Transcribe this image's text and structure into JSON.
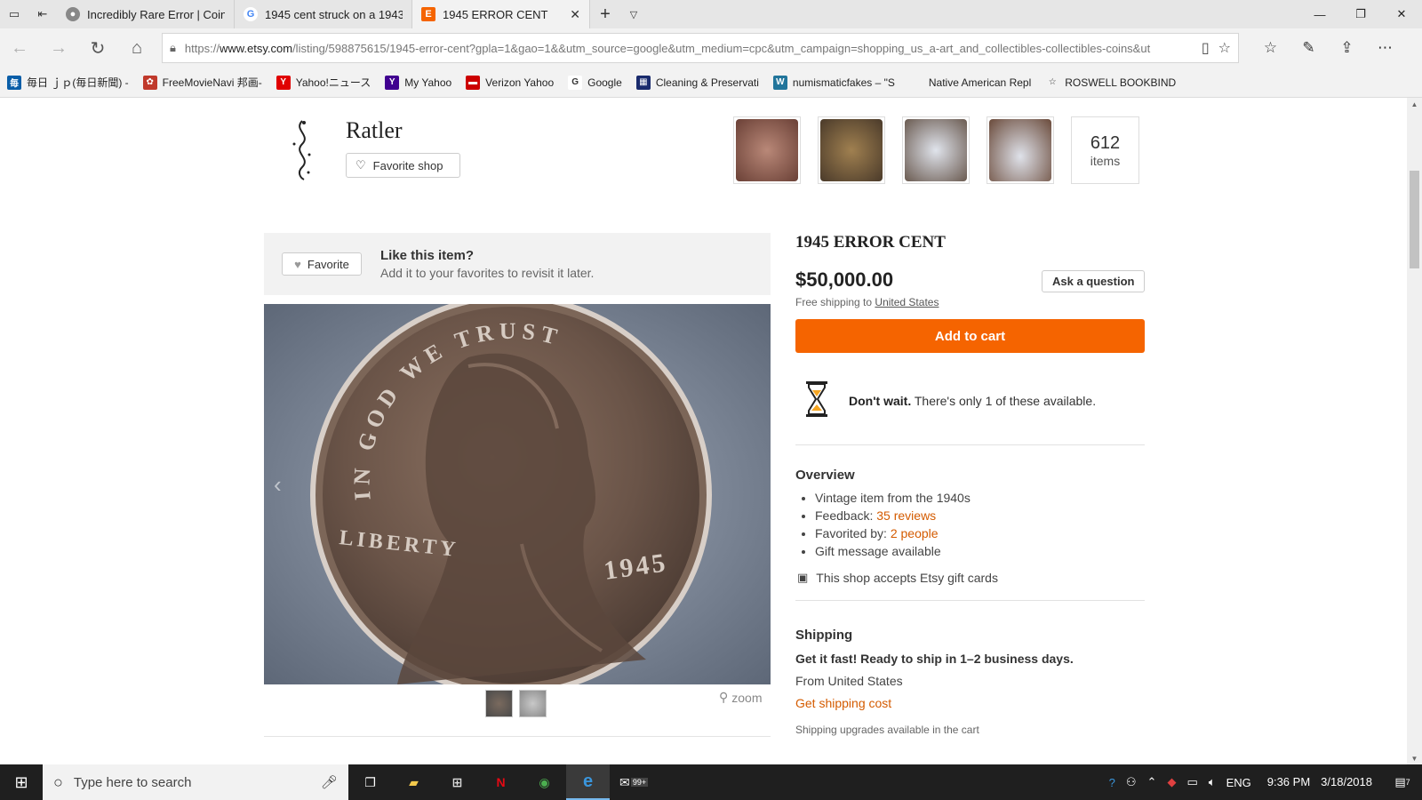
{
  "browser": {
    "tabs": [
      {
        "title": "Incredibly Rare Error | Coin",
        "favicon": "coin-favicon",
        "favicon_color": "#888888"
      },
      {
        "title": "1945 cent struck on a 1943",
        "favicon": "google-favicon",
        "favicon_color": "#4285f4"
      },
      {
        "title": "1945 ERROR CENT",
        "favicon": "etsy-favicon",
        "favicon_color": "#f56400",
        "active": true
      }
    ],
    "url_prefix": "https://",
    "url_domain": "www.etsy.com",
    "url_rest": "/listing/598875615/1945-error-cent?gpla=1&gao=1&&utm_source=google&utm_medium=cpc&utm_campaign=shopping_us_a-art_and_collectibles-collectibles-coins&ut",
    "favorites": [
      {
        "label": "毎日 ｊｐ(毎日新聞) -",
        "icon": "mainichi-icon",
        "color": "#0a5ea8",
        "glyph": "毎"
      },
      {
        "label": "FreeMovieNavi 邦画-",
        "icon": "freemovie-icon",
        "color": "#c0392b",
        "glyph": "✿"
      },
      {
        "label": "Yahoo!ニュース",
        "icon": "yahoo-jp-icon",
        "color": "#e00000",
        "glyph": "Y"
      },
      {
        "label": "My Yahoo",
        "icon": "yahoo-icon",
        "color": "#400090",
        "glyph": "Y"
      },
      {
        "label": "Verizon Yahoo",
        "icon": "verizon-icon",
        "color": "#cc0000",
        "glyph": "▬"
      },
      {
        "label": "Google",
        "icon": "google-icon",
        "color": "#ffffff",
        "glyph": "G"
      },
      {
        "label": "Cleaning & Preservati",
        "icon": "cleaning-icon",
        "color": "#1a2b6d",
        "glyph": "▦"
      },
      {
        "label": "numismaticfakes – \"S",
        "icon": "wordpress-icon",
        "color": "#21759b",
        "glyph": "W"
      },
      {
        "label": "Native American Repl",
        "icon": "blank-icon",
        "color": "#f2f2f2",
        "glyph": ""
      },
      {
        "label": "ROSWELL BOOKBIND",
        "icon": "star-icon",
        "color": "#f2f2f2",
        "glyph": "☆"
      }
    ]
  },
  "shop": {
    "name": "Ratler",
    "favorite_shop_label": "Favorite shop",
    "item_count": "612",
    "item_count_label": "items",
    "thumbnail_colors": [
      "#9a6a5a",
      "#7a6a4a",
      "#8a8f9a",
      "#6a5a58"
    ]
  },
  "like_box": {
    "favorite_label": "Favorite",
    "heading": "Like this item?",
    "subtext": "Add it to your favorites to revisit it later."
  },
  "image": {
    "coin_text_top": "IN GOD WE TRUST",
    "coin_text_left": "LIBERTY",
    "coin_year": "1945",
    "zoom_label": "zoom"
  },
  "listing": {
    "title": "1945 ERROR CENT",
    "price": "$50,000.00",
    "free_shipping_prefix": "Free shipping to",
    "free_shipping_country": "United States",
    "ask_label": "Ask a question",
    "add_to_cart_label": "Add to cart",
    "accent_color": "#f56400",
    "dont_wait_bold": "Don't wait.",
    "dont_wait_rest": "There's only 1 of these available."
  },
  "overview": {
    "title": "Overview",
    "items": [
      {
        "text": "Vintage item from the 1940s",
        "link": ""
      },
      {
        "text": "Feedback:",
        "link": "35 reviews"
      },
      {
        "text": "Favorited by:",
        "link": "2 people"
      },
      {
        "text": "Gift message available",
        "link": ""
      }
    ],
    "gift_cards": "This shop accepts Etsy gift cards"
  },
  "shipping": {
    "title": "Shipping",
    "fast": "Get it fast! Ready to ship in 1–2 business days.",
    "from": "From United States",
    "cost_link": "Get shipping cost",
    "upgrades": "Shipping upgrades available in the cart"
  },
  "taskbar": {
    "search_placeholder": "Type here to search",
    "apps": [
      {
        "name": "task-view",
        "glyph": "❐"
      },
      {
        "name": "file-explorer",
        "glyph": "▬",
        "color": "#f2c94c"
      },
      {
        "name": "store",
        "glyph": "⊞",
        "color": "#cccccc"
      },
      {
        "name": "netflix",
        "glyph": "N",
        "color": "#e50914"
      },
      {
        "name": "chrome",
        "glyph": "◉",
        "color": "#4caf50"
      },
      {
        "name": "edge",
        "glyph": "e",
        "color": "#3a96dd",
        "active": true
      },
      {
        "name": "mail",
        "glyph": "✉",
        "badge": "99+"
      }
    ],
    "language": "ENG",
    "time": "9:36 PM",
    "date": "3/18/2018",
    "notification_count": "7"
  }
}
